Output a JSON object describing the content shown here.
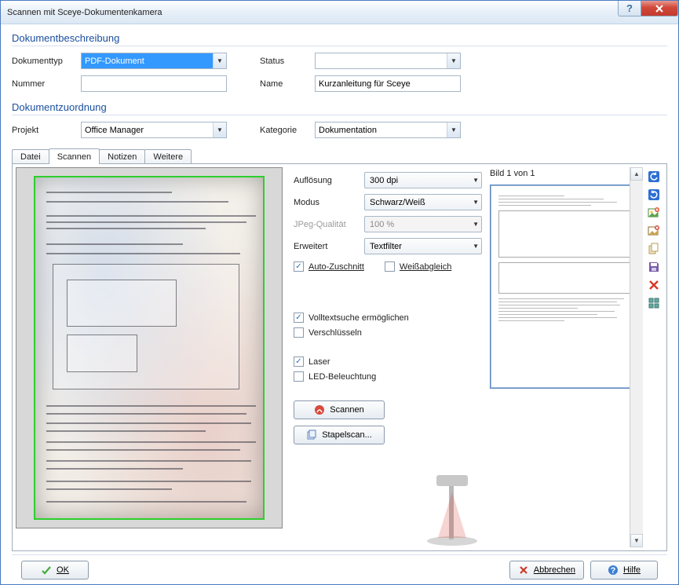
{
  "window": {
    "title": "Scannen mit Sceye-Dokumentenkamera"
  },
  "desc": {
    "header": "Dokumentbeschreibung",
    "doctype_label": "Dokumenttyp",
    "doctype_value": "PDF-Dokument",
    "status_label": "Status",
    "status_value": "",
    "number_label": "Nummer",
    "number_value": "",
    "name_label": "Name",
    "name_value": "Kurzanleitung für Sceye"
  },
  "assign": {
    "header": "Dokumentzuordnung",
    "project_label": "Projekt",
    "project_value": "Office Manager",
    "category_label": "Kategorie",
    "category_value": "Dokumentation"
  },
  "tabs": {
    "file": "Datei",
    "scan": "Scannen",
    "notes": "Notizen",
    "more": "Weitere"
  },
  "scan": {
    "resolution_label": "Auflösung",
    "resolution_value": "300 dpi",
    "mode_label": "Modus",
    "mode_value": "Schwarz/Weiß",
    "jpeg_label": "JPeg-Qualität",
    "jpeg_value": "100 %",
    "advanced_label": "Erweitert",
    "advanced_value": "Textfilter",
    "auto_crop": "Auto-Zuschnitt",
    "white_balance": "Weißabgleich",
    "fulltext": "Volltextsuche ermöglichen",
    "encrypt": "Verschlüsseln",
    "laser": "Laser",
    "led": "LED-Beleuchtung",
    "scan_btn": "Scannen",
    "batch_btn": "Stapelscan...",
    "auto_crop_checked": true,
    "white_balance_checked": false,
    "fulltext_checked": true,
    "encrypt_checked": false,
    "laser_checked": true,
    "led_checked": false
  },
  "thumbs": {
    "header": "Bild 1 von 1"
  },
  "footer": {
    "ok": "OK",
    "cancel": "Abbrechen",
    "help": "Hilfe"
  },
  "toolbar_icons": [
    "rotate-left-icon",
    "rotate-right-icon",
    "image-add-icon",
    "image-delete-icon",
    "copy-icon",
    "save-icon",
    "delete-icon",
    "select-all-icon"
  ]
}
